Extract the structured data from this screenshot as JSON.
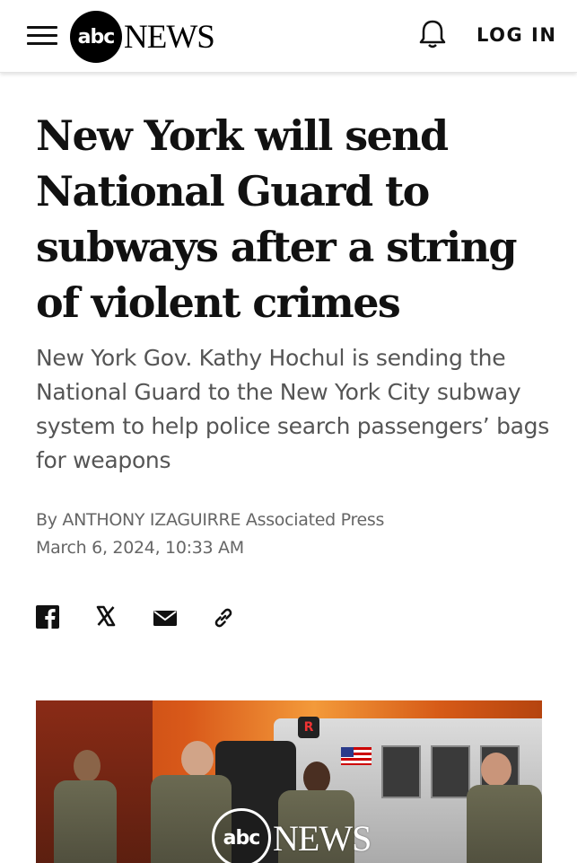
{
  "header": {
    "logo_mark": "abc",
    "logo_word": "NEWS",
    "login_label": "LOG IN",
    "icons": [
      "menu-icon",
      "bell-icon"
    ]
  },
  "article": {
    "headline": "New York will send National Guard to subways after a string of violent crimes",
    "subheadline": "New York Gov. Kathy Hochul is sending the National Guard to the New York City subway system to help police search passengers’ bags for weapons",
    "byline": "By ANTHONY IZAGUIRRE Associated Press",
    "date": "March 6, 2024, 10:33 AM",
    "share_icons": [
      "facebook-icon",
      "x-icon",
      "email-icon",
      "link-icon"
    ]
  },
  "hero_image": {
    "sign_letter": "R",
    "watermark_mark": "abc",
    "watermark_word": "NEWS"
  },
  "colors": {
    "text": "#111111",
    "subtext": "#555555",
    "meta": "#666666",
    "header_bg": "#ffffff"
  }
}
